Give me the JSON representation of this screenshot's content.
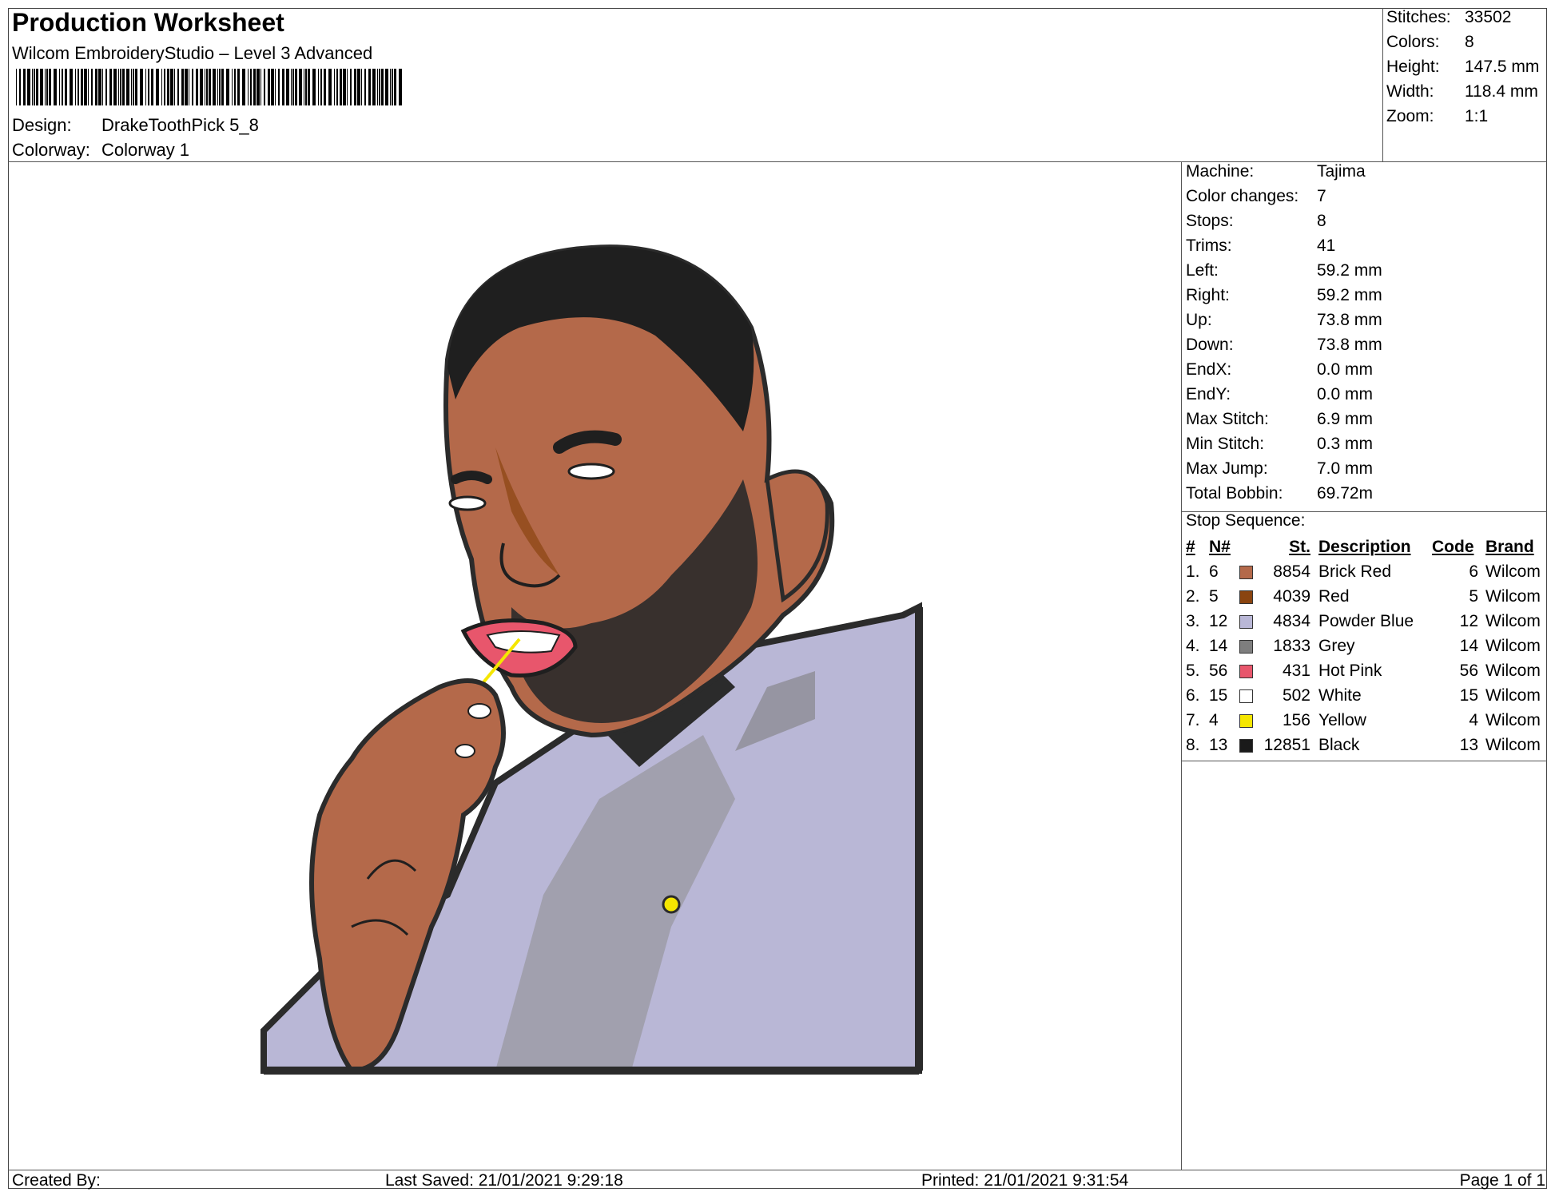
{
  "header": {
    "title": "Production Worksheet",
    "software": "Wilcom EmbroideryStudio – Level 3 Advanced",
    "design_label": "Design:",
    "design_value": "DrakeToothPick 5_8",
    "colorway_label": "Colorway:",
    "colorway_value": "Colorway 1"
  },
  "summary": [
    {
      "label": "Stitches:",
      "value": "33502"
    },
    {
      "label": "Colors:",
      "value": "8"
    },
    {
      "label": "Height:",
      "value": "147.5 mm"
    },
    {
      "label": "Width:",
      "value": "118.4 mm"
    },
    {
      "label": "Zoom:",
      "value": "1:1"
    }
  ],
  "machine_info": [
    {
      "label": "Machine:",
      "value": "Tajima"
    },
    {
      "label": "Color changes:",
      "value": "7"
    },
    {
      "label": "Stops:",
      "value": "8"
    },
    {
      "label": "Trims:",
      "value": "41"
    },
    {
      "label": "Left:",
      "value": "59.2 mm"
    },
    {
      "label": "Right:",
      "value": "59.2 mm"
    },
    {
      "label": "Up:",
      "value": "73.8 mm"
    },
    {
      "label": "Down:",
      "value": "73.8 mm"
    },
    {
      "label": "EndX:",
      "value": "0.0 mm"
    },
    {
      "label": "EndY:",
      "value": "0.0 mm"
    },
    {
      "label": "Max Stitch:",
      "value": "6.9 mm"
    },
    {
      "label": "Min Stitch:",
      "value": "0.3 mm"
    },
    {
      "label": "Max Jump:",
      "value": "7.0 mm"
    },
    {
      "label": "Total Bobbin:",
      "value": "69.72m"
    }
  ],
  "stop_sequence": {
    "title": "Stop Sequence:",
    "headers": {
      "num": "#",
      "n": "N#",
      "st": "St.",
      "description": "Description",
      "code": "Code",
      "brand": "Brand"
    },
    "rows": [
      {
        "num": "1.",
        "n": "6",
        "color": "#b4694a",
        "st": "8854",
        "description": "Brick Red",
        "code": "6",
        "brand": "Wilcom"
      },
      {
        "num": "2.",
        "n": "5",
        "color": "#8a4410",
        "st": "4039",
        "description": "Red",
        "code": "5",
        "brand": "Wilcom"
      },
      {
        "num": "3.",
        "n": "12",
        "color": "#b9b7d6",
        "st": "4834",
        "description": "Powder Blue",
        "code": "12",
        "brand": "Wilcom"
      },
      {
        "num": "4.",
        "n": "14",
        "color": "#7e7e7e",
        "st": "1833",
        "description": "Grey",
        "code": "14",
        "brand": "Wilcom"
      },
      {
        "num": "5.",
        "n": "56",
        "color": "#e8566c",
        "st": "431",
        "description": "Hot Pink",
        "code": "56",
        "brand": "Wilcom"
      },
      {
        "num": "6.",
        "n": "15",
        "color": "#ffffff",
        "st": "502",
        "description": "White",
        "code": "15",
        "brand": "Wilcom"
      },
      {
        "num": "7.",
        "n": "4",
        "color": "#f5e600",
        "st": "156",
        "description": "Yellow",
        "code": "4",
        "brand": "Wilcom"
      },
      {
        "num": "8.",
        "n": "13",
        "color": "#1a1a1a",
        "st": "12851",
        "description": "Black",
        "code": "13",
        "brand": "Wilcom"
      }
    ]
  },
  "footer": {
    "created_by": "Created By:",
    "last_saved": "Last Saved: 21/01/2021 9:29:18",
    "printed": "Printed: 21/01/2021 9:31:54",
    "page": "Page 1 of 1"
  }
}
